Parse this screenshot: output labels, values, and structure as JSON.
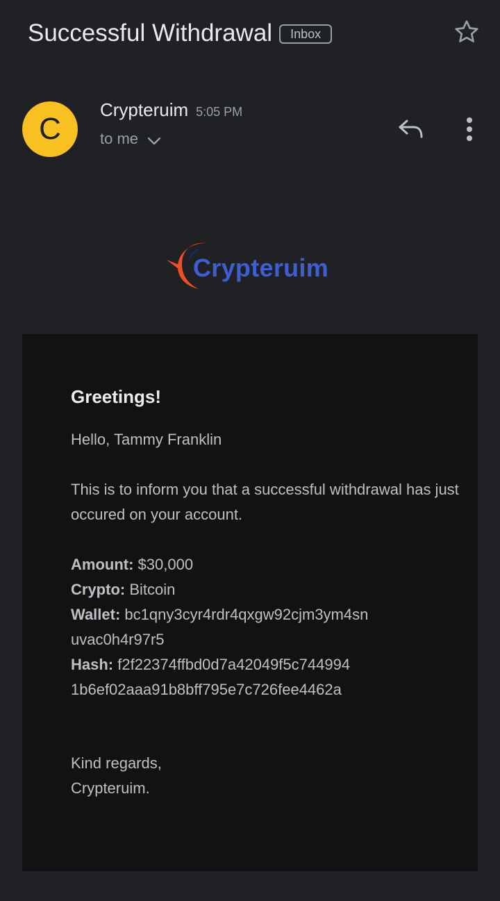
{
  "email": {
    "subject": "Successful Withdrawal",
    "label": "Inbox",
    "sender": {
      "initial": "C",
      "name": "Crypteruim",
      "time": "5:05 PM",
      "recipient": "to me",
      "avatar_color": "#f9c021"
    }
  },
  "icons": {
    "star": "star-outline-icon",
    "chevron": "chevron-down-icon",
    "reply": "reply-icon",
    "more": "more-vertical-icon"
  },
  "body": {
    "logo_text": "Crypteruim",
    "greeting": "Greetings!",
    "salutation": "Hello, Tammy Franklin",
    "intro": "This is to inform you that a successful withdrawal has just occured on your account.",
    "details": [
      {
        "label": "Amount:",
        "value": "$30,000"
      },
      {
        "label": "Crypto:",
        "value": "Bitcoin"
      },
      {
        "label": "Wallet:",
        "value": "bc1qny3cyr4rdr4qxgw92cjm3ym4sn uvac0h4r97r5"
      },
      {
        "label": "Hash:",
        "value": "f2f22374ffbd0d7a42049f5c744994 1b6ef02aaa91b8bff795e7c726fee4462a"
      }
    ],
    "closing_1": "Kind regards,",
    "closing_2": "Crypteruim."
  },
  "colors": {
    "background": "#202124",
    "card": "#121212",
    "logo_blue": "#3e5fd1",
    "logo_orange": "#f04e23"
  }
}
